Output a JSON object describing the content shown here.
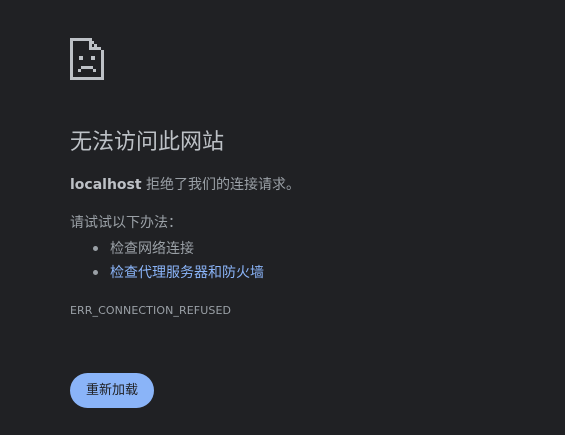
{
  "error_icon": "sad-page-icon",
  "heading": "无法访问此网站",
  "summary": {
    "host": "localhost",
    "message": " 拒绝了我们的连接请求。"
  },
  "suggestions": {
    "intro": "请试试以下办法：",
    "items": [
      {
        "label": "检查网络连接",
        "is_link": false
      },
      {
        "label": "检查代理服务器和防火墙",
        "is_link": true
      }
    ]
  },
  "error_code": "ERR_CONNECTION_REFUSED",
  "reload_button": {
    "label": "重新加载"
  },
  "colors": {
    "background": "#202124",
    "heading": "#bdc1c6",
    "text": "#9aa0a6",
    "link": "#8ab4f8",
    "button": "#8ab4f8"
  }
}
